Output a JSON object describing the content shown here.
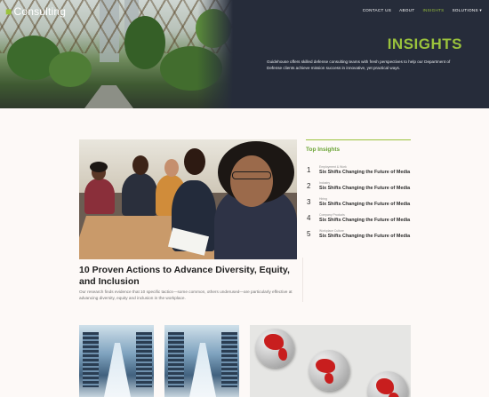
{
  "header": {
    "brand_mark": "■",
    "brand_name": "Consulting",
    "nav": [
      {
        "label": "CONTACT US"
      },
      {
        "label": "ABOUT"
      },
      {
        "label": "INSIGHTS"
      },
      {
        "label": "SOLUTIONS ▾"
      }
    ],
    "active_nav": "INSIGHTS"
  },
  "hero": {
    "title": "INSIGHTS",
    "description": "Guidehouse offers skilled defense consulting teams with fresh perspectives to help our Department of Defense clients achieve mission success in innovative, yet practical ways."
  },
  "feature": {
    "title": "10 Proven Actions to Advance Diversity, Equity, and Inclusion",
    "summary": "Our research finds evidence that 10 specific tactics—some common, others underused—are particularly effective at advancing diversity, equity and inclusion in the workplace."
  },
  "sidebar": {
    "title": "Top Insights",
    "items": [
      {
        "number": "1",
        "category": "Employment & Work",
        "title": "Six Shifts Changing the Future of Media"
      },
      {
        "number": "2",
        "category": "Industry",
        "title": "Six Shifts Changing the Future of Media"
      },
      {
        "number": "3",
        "category": "Hiring",
        "title": "Six Shifts Changing the Future of Media"
      },
      {
        "number": "4",
        "category": "Company Products",
        "title": "Six Shifts Changing the Future of Media"
      },
      {
        "number": "5",
        "category": "Workplace Culture",
        "title": "Six Shifts Changing the Future of Media"
      }
    ]
  },
  "colors": {
    "accent": "#9ac23c",
    "hero_bg": "#262c3a",
    "page_bg": "#fdf9f7",
    "globe_land": "#c81e1e"
  },
  "icons": {
    "dropdown": "chevron-down-icon"
  }
}
